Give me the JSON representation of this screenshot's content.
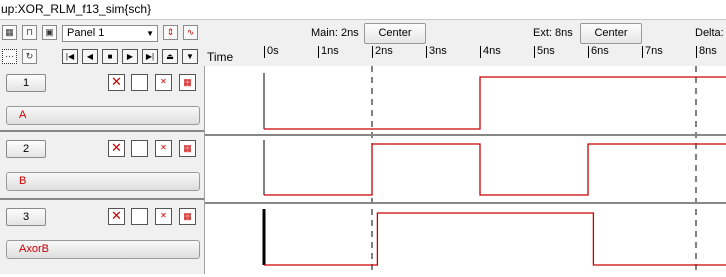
{
  "window": {
    "title": "up:XOR_RLM_f13_sim{sch}"
  },
  "toolbar": {
    "panel_value": "Panel 1",
    "main_label": "Main: 2ns",
    "center_label": "Center",
    "ext_label": "Ext: 8ns",
    "ext_center_label": "Center",
    "delta_label": "Delta:",
    "time_label": "Time"
  },
  "ruler": {
    "ticks": [
      "0s",
      "1ns",
      "2ns",
      "3ns",
      "4ns",
      "5ns",
      "6ns",
      "7ns",
      "8ns"
    ]
  },
  "signals": [
    {
      "number": "1",
      "name": "A"
    },
    {
      "number": "2",
      "name": "B"
    },
    {
      "number": "3",
      "name": "AxorB"
    }
  ],
  "waveforms": {
    "A": [
      [
        0,
        0
      ],
      [
        4,
        1
      ],
      [
        8.6,
        1
      ]
    ],
    "B": [
      [
        0,
        0
      ],
      [
        2,
        1
      ],
      [
        4,
        0
      ],
      [
        6,
        1
      ],
      [
        8.6,
        1
      ]
    ],
    "AxorB": [
      [
        0,
        0
      ],
      [
        2.1,
        1
      ],
      [
        6.1,
        0
      ],
      [
        8.6,
        0
      ]
    ]
  },
  "colors": {
    "wave": "#cc0000",
    "signal_text": "#cc0000"
  }
}
